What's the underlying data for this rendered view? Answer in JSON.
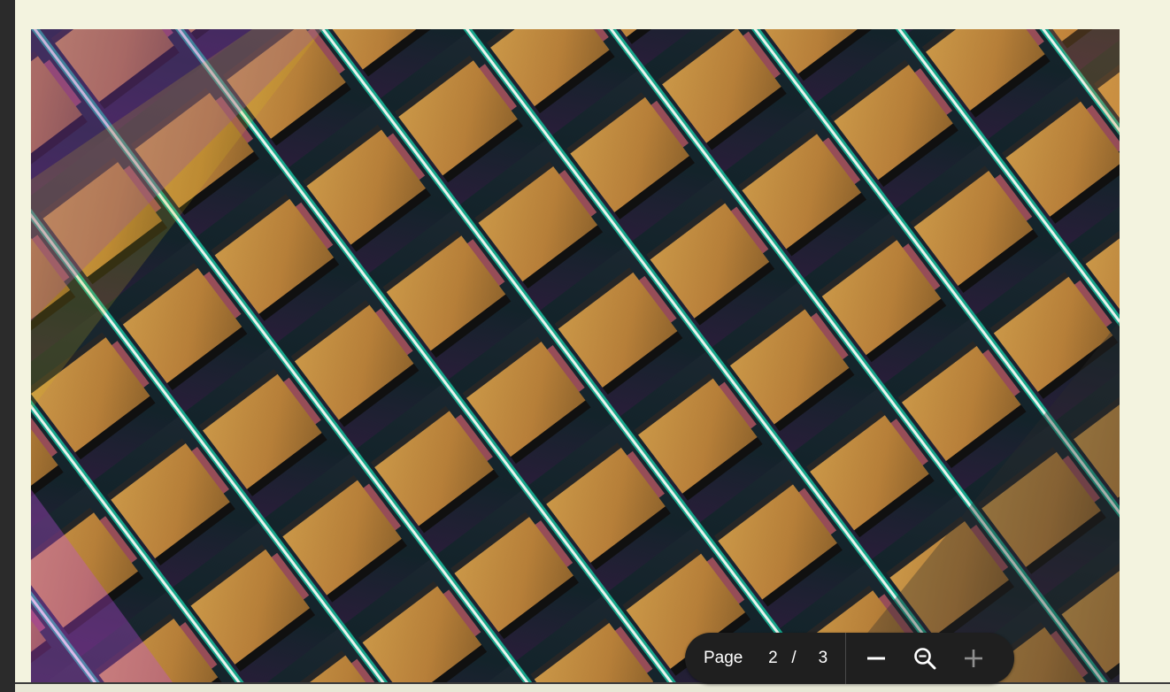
{
  "document": {
    "page_image": "colorful-glass-facade-photo"
  },
  "toolbar": {
    "page_label": "Page",
    "current_page": "2",
    "separator": "/",
    "total_pages": "3",
    "zoom_out_icon": "minus-icon",
    "zoom_reset_icon": "magnifier-icon",
    "zoom_in_icon": "plus-icon"
  },
  "colors": {
    "background": "#f3f3df",
    "toolbar": "#1f1f1f",
    "toolbar_text": "#ffffff",
    "rail": "#2b2b2b"
  }
}
